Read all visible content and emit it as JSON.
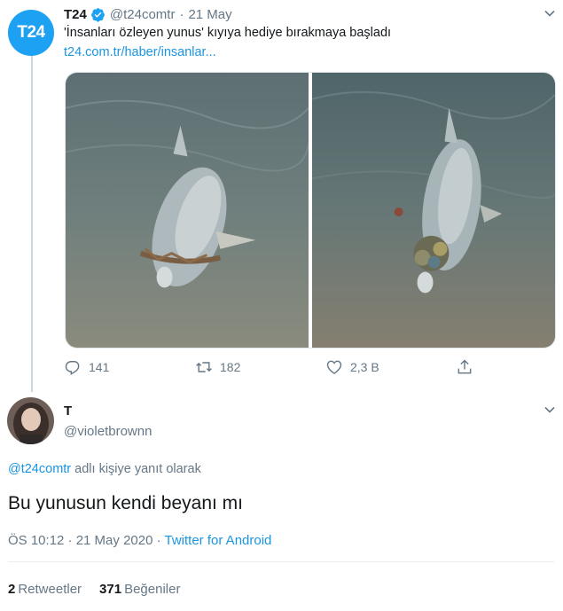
{
  "tweet": {
    "avatar_text": "T24",
    "author_name": "T24",
    "handle": "@t24comtr",
    "separator": "·",
    "date": "21 May",
    "text": "'İnsanları özleyen yunus' kıyıya hediye bırakmaya başladı",
    "link": "t24.com.tr/haber/insanlar...",
    "replies": "141",
    "retweets": "182",
    "likes": "2,3 B"
  },
  "reply": {
    "author_name": "T",
    "handle": "@violetbrownn",
    "replying_to_handle": "@t24comtr",
    "replying_to_text": " adlı kişiye yanıt olarak",
    "text": "Bu yunusun kendi beyanı mı",
    "time": "ÖS 10:12 · 21 May 2020 · ",
    "client": "Twitter for Android",
    "retweets_count": "2",
    "retweets_label": "Retweetler",
    "likes_count": "371",
    "likes_label": "Beğeniler"
  },
  "colors": {
    "accent": "#1da1f2",
    "link": "#1b95e0",
    "muted": "#657786"
  }
}
